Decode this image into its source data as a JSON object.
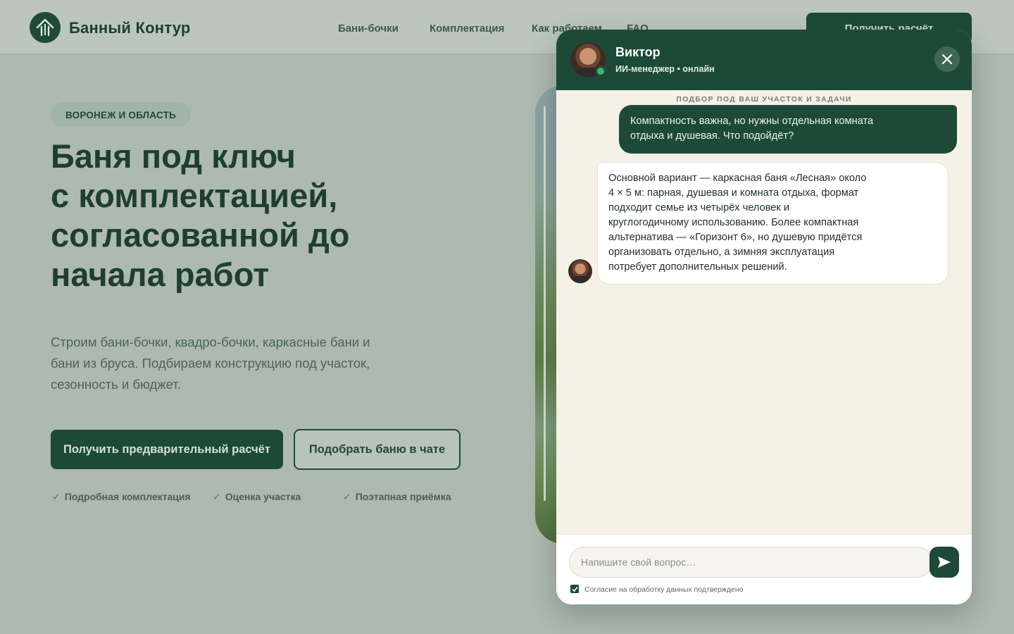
{
  "brand": {
    "name": "Банный Контур",
    "logo_icon": "house-tree-icon"
  },
  "nav": {
    "items": [
      "Бани-бочки",
      "Комплектация",
      "Как работаем",
      "FAQ"
    ],
    "cta": "Получить расчёт"
  },
  "hero": {
    "badge": "ВОРОНЕЖ И ОБЛАСТЬ",
    "title_lines": [
      "Баня под ключ",
      "с комплектацией,",
      "согласованной до",
      "начала работ"
    ],
    "subtitle": "Строим бани-бочки, квадро-бочки, каркасные бани и бани из бруса. Подбираем конструкцию под участок, сезонность и бюджет.",
    "primary_button": "Получить предварительный расчёт",
    "secondary_button": "Подобрать баню в чате",
    "features": [
      "Подробная комплектация",
      "Оценка участка",
      "Поэтапная приёмка"
    ],
    "check_symbol": "✓"
  },
  "chat": {
    "agent_name": "Виктор",
    "agent_role": "ИИ-менеджер • онлайн",
    "status_color": "#42b36a",
    "context_label": "ПОДБОР ПОД ВАШ УЧАСТОК И ЗАДАЧИ",
    "messages": [
      {
        "from": "user",
        "lines": [
          "Компактность важна, но нужны отдельная комната",
          "отдыха и душевая. Что подойдёт?"
        ]
      },
      {
        "from": "bot",
        "lines": [
          "Основной вариант — каркасная баня «Лесная» около",
          "4 × 5 м: парная, душевая и комната отдыха, формат",
          "подходит семье из четырёх человек и",
          "круглогодичному использованию. Более компактная",
          "альтернатива — «Горизонт 6», но душевую придётся",
          "организовать отдельно, а зимняя эксплуатация",
          "потребует дополнительных решений."
        ]
      }
    ],
    "input_placeholder": "Напишите свой вопрос…",
    "consent": "Согласие на обработку данных подтверждено",
    "consent_checked": true
  },
  "colors": {
    "brand_green": "#1d4a38",
    "chat_bg": "#f5f1e7"
  }
}
